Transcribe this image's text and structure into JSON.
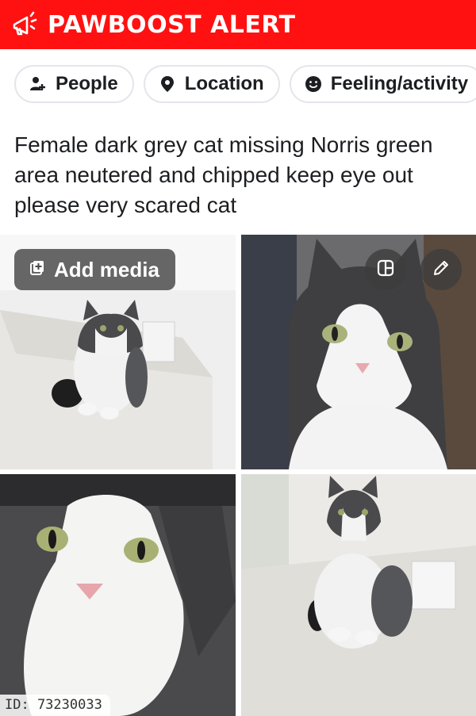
{
  "alert": {
    "title": "PAWBOOST ALERT",
    "icon": "megaphone-icon",
    "color": "#ff1111"
  },
  "chips": [
    {
      "label": "People",
      "icon": "people-icon"
    },
    {
      "label": "Location",
      "icon": "location-pin-icon"
    },
    {
      "label": "Feeling/activity",
      "icon": "smiley-icon"
    }
  ],
  "post": {
    "text": "Female dark grey cat missing Norris green area neutered and chipped keep eye out please very scared cat"
  },
  "media": {
    "add_label": "Add media"
  },
  "footer": {
    "id_text": "ID: 73230033"
  }
}
